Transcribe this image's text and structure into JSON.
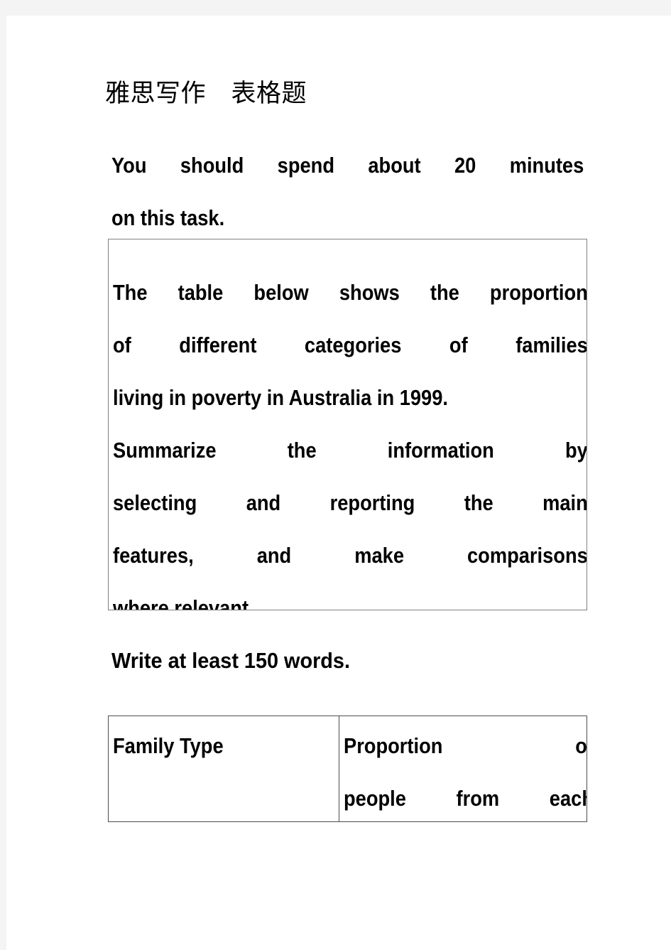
{
  "document": {
    "title_cn": "雅思写作　表格题",
    "intro": {
      "line1": "You should spend about 20 minutes",
      "line2": "on this task."
    },
    "prompt_box": {
      "line1": "The table below shows the proportion",
      "line2": "of different categories of families",
      "line3": "living in poverty in Australia in 1999.",
      "line4": "Summarize the information by",
      "line5": "selecting and reporting the main",
      "line6": "features, and make comparisons",
      "line7": "where relevant."
    },
    "word_count_note": "Write at least 150 words.",
    "table": {
      "headers": {
        "col1": "Family Type",
        "col2_line1": "Proportion of",
        "col2_line2": "people from each"
      }
    }
  },
  "colors": {
    "page_background": "#ffffff",
    "canvas_margin": "#f4f4f4",
    "text": "#000000",
    "box_border": "#808080",
    "table_border": "#4d4d4d"
  }
}
